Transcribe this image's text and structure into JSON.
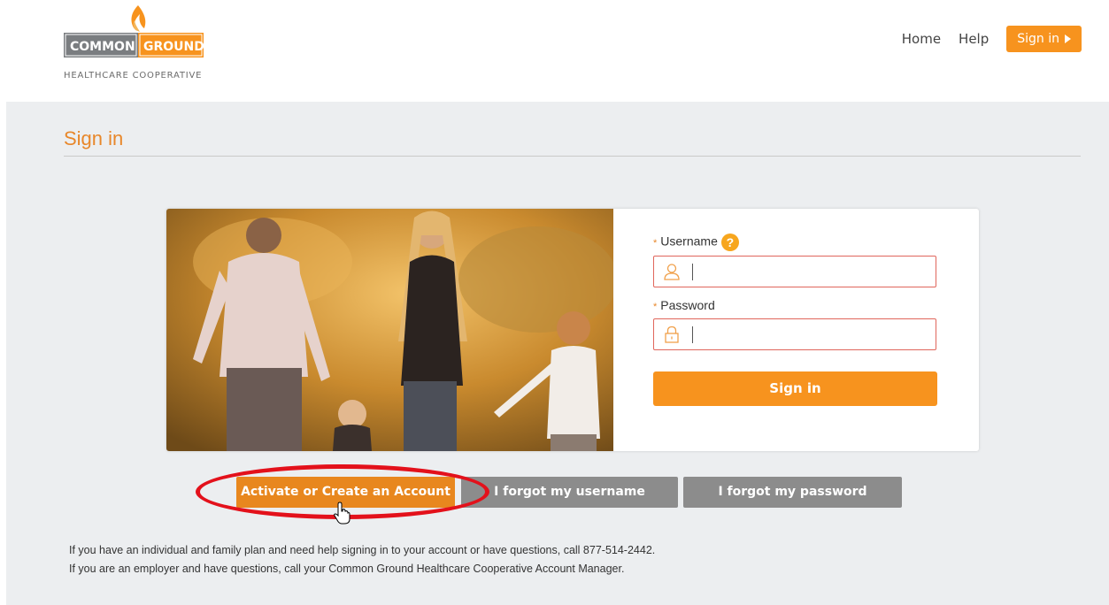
{
  "logo": {
    "word1": "COMMON",
    "word2": "GROUND",
    "tagline": "HEALTHCARE COOPERATIVE"
  },
  "nav": {
    "home": "Home",
    "help": "Help",
    "signin": "Sign in"
  },
  "page": {
    "title": "Sign in"
  },
  "form": {
    "username_label": "Username",
    "help_badge": "?",
    "password_label": "Password",
    "required_marker": "*",
    "username_value": "",
    "password_value": "",
    "signin_button": "Sign in"
  },
  "actions": {
    "activate": "Activate or Create an Account",
    "forgot_username": "I forgot my username",
    "forgot_password": "I forgot my password"
  },
  "info": {
    "line1": "If you have an individual and family plan and need help signing in to your account or have questions, call 877-514-2442.",
    "line2": "If you are an employer and have questions, call your Common Ground Healthcare Cooperative Account Manager."
  },
  "colors": {
    "brand_orange": "#f7931e",
    "title_orange": "#e8872a",
    "button_grey": "#8c8c8c",
    "annotation_red": "#e3111b"
  },
  "icons": {
    "user": "user-icon",
    "lock": "lock-icon",
    "caret": "caret-right-icon",
    "cursor": "hand-pointer-icon"
  }
}
